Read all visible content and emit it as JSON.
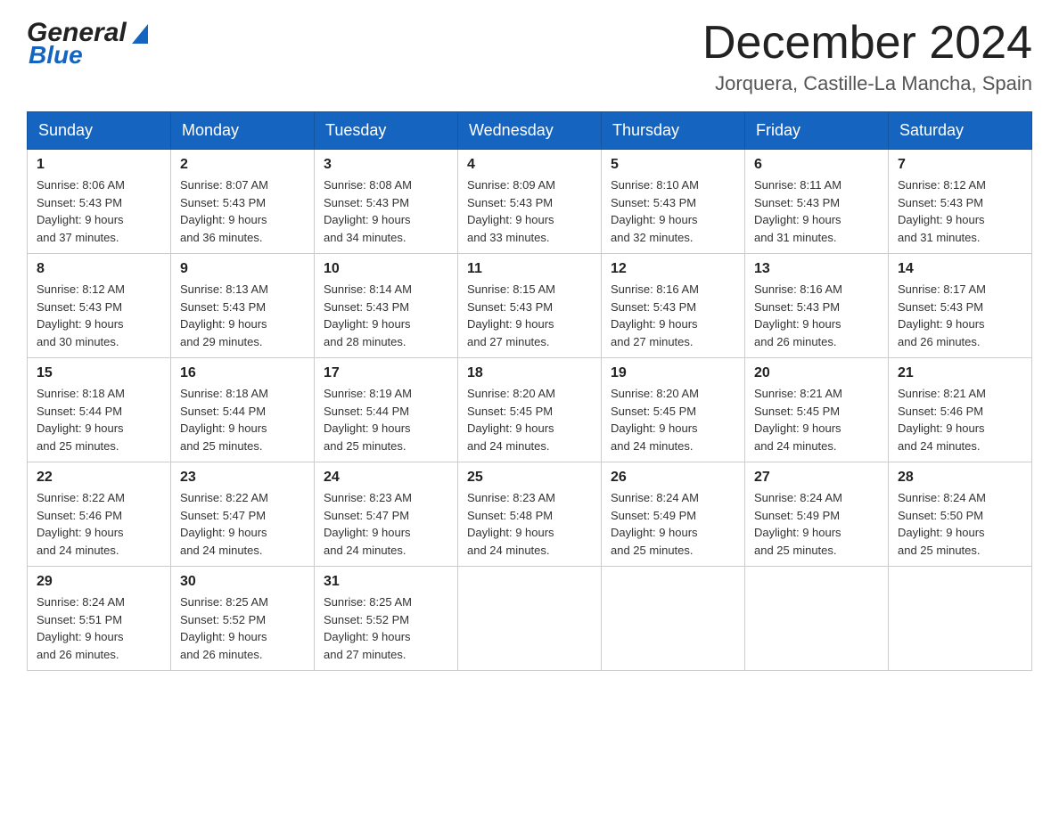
{
  "header": {
    "month_title": "December 2024",
    "location": "Jorquera, Castille-La Mancha, Spain",
    "logo_general": "General",
    "logo_blue": "Blue"
  },
  "days_of_week": [
    "Sunday",
    "Monday",
    "Tuesday",
    "Wednesday",
    "Thursday",
    "Friday",
    "Saturday"
  ],
  "weeks": [
    [
      {
        "day": "1",
        "sunrise": "8:06 AM",
        "sunset": "5:43 PM",
        "daylight": "9 hours and 37 minutes."
      },
      {
        "day": "2",
        "sunrise": "8:07 AM",
        "sunset": "5:43 PM",
        "daylight": "9 hours and 36 minutes."
      },
      {
        "day": "3",
        "sunrise": "8:08 AM",
        "sunset": "5:43 PM",
        "daylight": "9 hours and 34 minutes."
      },
      {
        "day": "4",
        "sunrise": "8:09 AM",
        "sunset": "5:43 PM",
        "daylight": "9 hours and 33 minutes."
      },
      {
        "day": "5",
        "sunrise": "8:10 AM",
        "sunset": "5:43 PM",
        "daylight": "9 hours and 32 minutes."
      },
      {
        "day": "6",
        "sunrise": "8:11 AM",
        "sunset": "5:43 PM",
        "daylight": "9 hours and 31 minutes."
      },
      {
        "day": "7",
        "sunrise": "8:12 AM",
        "sunset": "5:43 PM",
        "daylight": "9 hours and 31 minutes."
      }
    ],
    [
      {
        "day": "8",
        "sunrise": "8:12 AM",
        "sunset": "5:43 PM",
        "daylight": "9 hours and 30 minutes."
      },
      {
        "day": "9",
        "sunrise": "8:13 AM",
        "sunset": "5:43 PM",
        "daylight": "9 hours and 29 minutes."
      },
      {
        "day": "10",
        "sunrise": "8:14 AM",
        "sunset": "5:43 PM",
        "daylight": "9 hours and 28 minutes."
      },
      {
        "day": "11",
        "sunrise": "8:15 AM",
        "sunset": "5:43 PM",
        "daylight": "9 hours and 27 minutes."
      },
      {
        "day": "12",
        "sunrise": "8:16 AM",
        "sunset": "5:43 PM",
        "daylight": "9 hours and 27 minutes."
      },
      {
        "day": "13",
        "sunrise": "8:16 AM",
        "sunset": "5:43 PM",
        "daylight": "9 hours and 26 minutes."
      },
      {
        "day": "14",
        "sunrise": "8:17 AM",
        "sunset": "5:43 PM",
        "daylight": "9 hours and 26 minutes."
      }
    ],
    [
      {
        "day": "15",
        "sunrise": "8:18 AM",
        "sunset": "5:44 PM",
        "daylight": "9 hours and 25 minutes."
      },
      {
        "day": "16",
        "sunrise": "8:18 AM",
        "sunset": "5:44 PM",
        "daylight": "9 hours and 25 minutes."
      },
      {
        "day": "17",
        "sunrise": "8:19 AM",
        "sunset": "5:44 PM",
        "daylight": "9 hours and 25 minutes."
      },
      {
        "day": "18",
        "sunrise": "8:20 AM",
        "sunset": "5:45 PM",
        "daylight": "9 hours and 24 minutes."
      },
      {
        "day": "19",
        "sunrise": "8:20 AM",
        "sunset": "5:45 PM",
        "daylight": "9 hours and 24 minutes."
      },
      {
        "day": "20",
        "sunrise": "8:21 AM",
        "sunset": "5:45 PM",
        "daylight": "9 hours and 24 minutes."
      },
      {
        "day": "21",
        "sunrise": "8:21 AM",
        "sunset": "5:46 PM",
        "daylight": "9 hours and 24 minutes."
      }
    ],
    [
      {
        "day": "22",
        "sunrise": "8:22 AM",
        "sunset": "5:46 PM",
        "daylight": "9 hours and 24 minutes."
      },
      {
        "day": "23",
        "sunrise": "8:22 AM",
        "sunset": "5:47 PM",
        "daylight": "9 hours and 24 minutes."
      },
      {
        "day": "24",
        "sunrise": "8:23 AM",
        "sunset": "5:47 PM",
        "daylight": "9 hours and 24 minutes."
      },
      {
        "day": "25",
        "sunrise": "8:23 AM",
        "sunset": "5:48 PM",
        "daylight": "9 hours and 24 minutes."
      },
      {
        "day": "26",
        "sunrise": "8:24 AM",
        "sunset": "5:49 PM",
        "daylight": "9 hours and 25 minutes."
      },
      {
        "day": "27",
        "sunrise": "8:24 AM",
        "sunset": "5:49 PM",
        "daylight": "9 hours and 25 minutes."
      },
      {
        "day": "28",
        "sunrise": "8:24 AM",
        "sunset": "5:50 PM",
        "daylight": "9 hours and 25 minutes."
      }
    ],
    [
      {
        "day": "29",
        "sunrise": "8:24 AM",
        "sunset": "5:51 PM",
        "daylight": "9 hours and 26 minutes."
      },
      {
        "day": "30",
        "sunrise": "8:25 AM",
        "sunset": "5:52 PM",
        "daylight": "9 hours and 26 minutes."
      },
      {
        "day": "31",
        "sunrise": "8:25 AM",
        "sunset": "5:52 PM",
        "daylight": "9 hours and 27 minutes."
      },
      null,
      null,
      null,
      null
    ]
  ],
  "labels": {
    "sunrise": "Sunrise:",
    "sunset": "Sunset:",
    "daylight": "Daylight:"
  }
}
